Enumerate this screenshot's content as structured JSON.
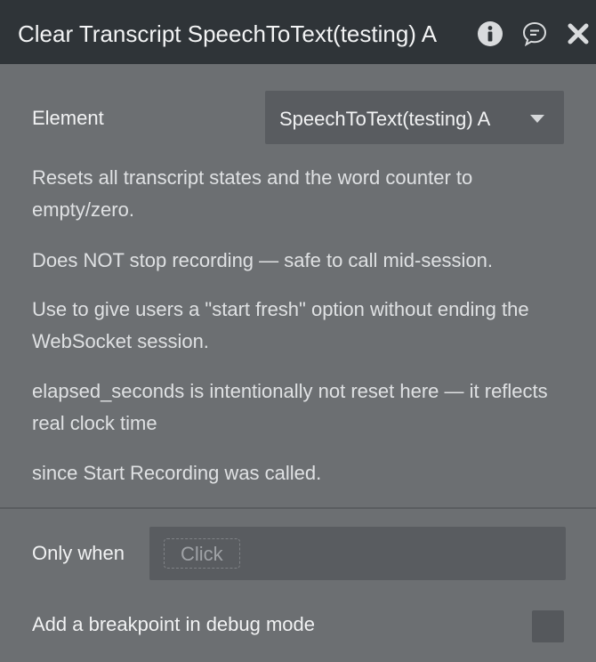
{
  "header": {
    "title": "Clear Transcript SpeechToText(testing) A",
    "icons": [
      "info-icon",
      "comment-icon",
      "close-icon"
    ]
  },
  "element_row": {
    "label": "Element",
    "selected_value": "SpeechToText(testing) A"
  },
  "description": {
    "line1": "Resets all transcript states and the word counter to empty/zero.",
    "line2": "Does NOT stop recording — safe to call mid-session.",
    "line3": "Use to give users a \"start fresh\" option without ending the WebSocket session.",
    "line4": "elapsed_seconds is intentionally not reset here — it reflects real clock time",
    "line5": "since Start Recording was called."
  },
  "only_when": {
    "label": "Only when",
    "placeholder": "Click"
  },
  "breakpoint": {
    "label": "Add a breakpoint in debug mode",
    "checked": false
  },
  "colors": {
    "header_bg": "#2f3438",
    "panel_bg": "#6c6f72",
    "field_bg": "#595c60"
  }
}
